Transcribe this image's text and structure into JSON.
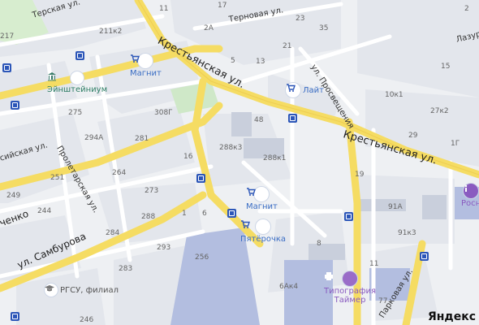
{
  "map": {
    "streets": {
      "krestyanskaya_top": "Крестьянская ул.",
      "krestyanskaya_right": "Крестьянская ул.",
      "terskaya": "Терская ул.",
      "ternovaya": "Терновая ул.",
      "prosvescheniya": "ул. Просвещения",
      "proletarskaya": "Пролетарская ул.",
      "samburova": "ул. Самбурова",
      "siyskaya": "сийская ул.",
      "chenko": "ченко",
      "lazur": "Лазур",
      "parkovaya": "Парковая ул."
    },
    "pois": {
      "magnit_top": "Магнит",
      "einstein": "Эйнштейниум",
      "lait": "Лайт",
      "magnit_center": "Магнит",
      "pyaterochka": "Пятёрочка",
      "rgsu": "РГСУ, филиал",
      "typography_line1": "Типография",
      "typography_line2": "Таймер",
      "rosn": "Росн"
    },
    "house_numbers": {
      "n11": "11",
      "n17": "17",
      "n2A": "2А",
      "n23": "23",
      "n35": "35",
      "n21": "21",
      "n5": "5",
      "n13": "13",
      "n211k2": "211к2",
      "n217": "217",
      "n15": "15",
      "n10k1": "10к1",
      "n27k2": "27к2",
      "n29": "29",
      "n1G": "1Г",
      "n48": "48",
      "n275": "275",
      "n308G": "308Г",
      "n294A": "294А",
      "n281": "281",
      "n288k3": "288к3",
      "n288k1": "288к1",
      "n16": "16",
      "n251": "251",
      "n264": "264",
      "n273": "273",
      "n249": "249",
      "n244": "244",
      "n288": "288",
      "n1": "1",
      "n6": "6",
      "n19": "19",
      "n91A": "91А",
      "n91k3": "91к3",
      "n8": "8",
      "n284": "284",
      "n293": "293",
      "n256": "256",
      "n283": "283",
      "n11b": "11",
      "n6Ak4": "6Ак4",
      "n246": "246",
      "n77": "77",
      "n2": "2"
    },
    "watermark": "Яндекс"
  },
  "colors": {
    "road_yellow": "#f5dc63",
    "road_white": "#ffffff",
    "block": "#e1e4ea",
    "park": "#cdebc8",
    "poi_blue": "#2c56b8",
    "building_blue": "#b3bee0"
  }
}
